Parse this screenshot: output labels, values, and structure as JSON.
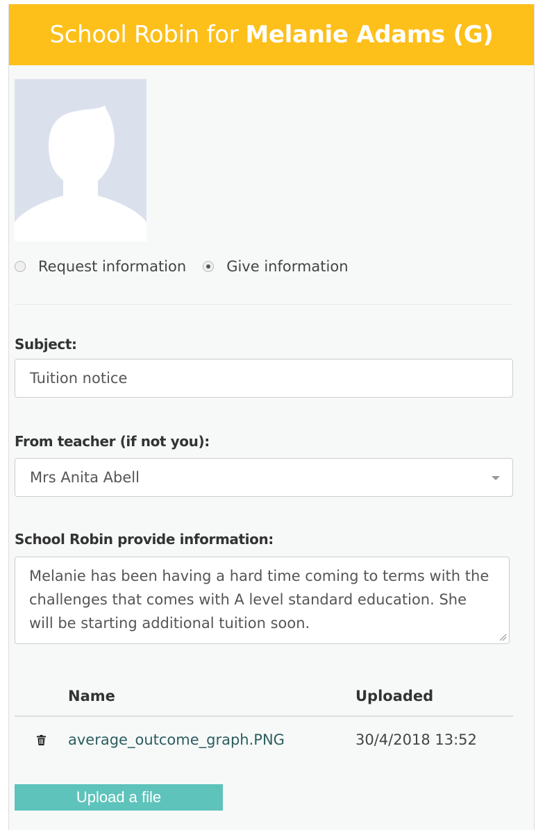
{
  "header": {
    "prefix": "School Robin for",
    "student_name": "Melanie Adams (G)",
    "color": "#fdbf1a"
  },
  "photo": {
    "icon": "person-silhouette-icon"
  },
  "mode": {
    "options": [
      {
        "label": "Request information",
        "checked": false
      },
      {
        "label": "Give information",
        "checked": true
      }
    ]
  },
  "form": {
    "subject_label": "Subject:",
    "subject_value": "Tuition notice",
    "teacher_label": "From teacher (if not you):",
    "teacher_value": "Mrs Anita Abell",
    "info_label": "School Robin provide information:",
    "info_value": "Melanie has been having a hard time coming to terms with the challenges that comes with A level standard education. She will be starting additional tuition soon."
  },
  "files": {
    "columns": {
      "name": "Name",
      "uploaded": "Uploaded"
    },
    "rows": [
      {
        "icon": "trash-icon",
        "name": "average_outcome_graph.PNG",
        "uploaded": "30/4/2018 13:52"
      }
    ]
  },
  "upload_button": {
    "label": "Upload a file",
    "color": "#5ec3bb"
  }
}
